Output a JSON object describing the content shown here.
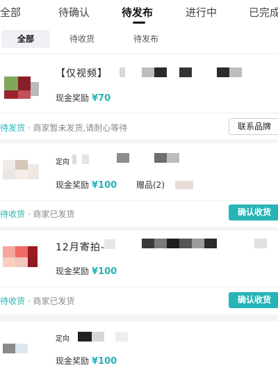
{
  "top_tabs": [
    {
      "label": "全部"
    },
    {
      "label": "待确认"
    },
    {
      "label": "待发布"
    },
    {
      "label": "进行中"
    },
    {
      "label": "已完成"
    }
  ],
  "sub_tabs": [
    {
      "label": "全部"
    },
    {
      "label": "待收货"
    },
    {
      "label": "待发布"
    }
  ],
  "orders": [
    {
      "title": "【仅视频】",
      "reward_label": "现金奖励",
      "reward_amount": "¥70",
      "status": "待发货",
      "status_note": " · 商家暂未发货,请耐心等待",
      "button": "联系品牌"
    },
    {
      "title": "定向",
      "reward_label": "现金奖励",
      "reward_amount": "¥100",
      "gift": "赠品(2)",
      "status": "待收货",
      "status_note": " · 商家已发货",
      "button": "确认收货"
    },
    {
      "title": "12月寄拍-",
      "reward_label": "现金奖励",
      "reward_amount": "¥100",
      "status": "待收货",
      "status_note": " · 商家已发货",
      "button": "确认收货"
    },
    {
      "title": "定向",
      "reward_label": "现金奖励",
      "reward_amount": "¥100"
    }
  ],
  "colors": {
    "accent": "#26b3b3",
    "button_fill": "#27b4b7",
    "background": "#f4f4f6"
  }
}
